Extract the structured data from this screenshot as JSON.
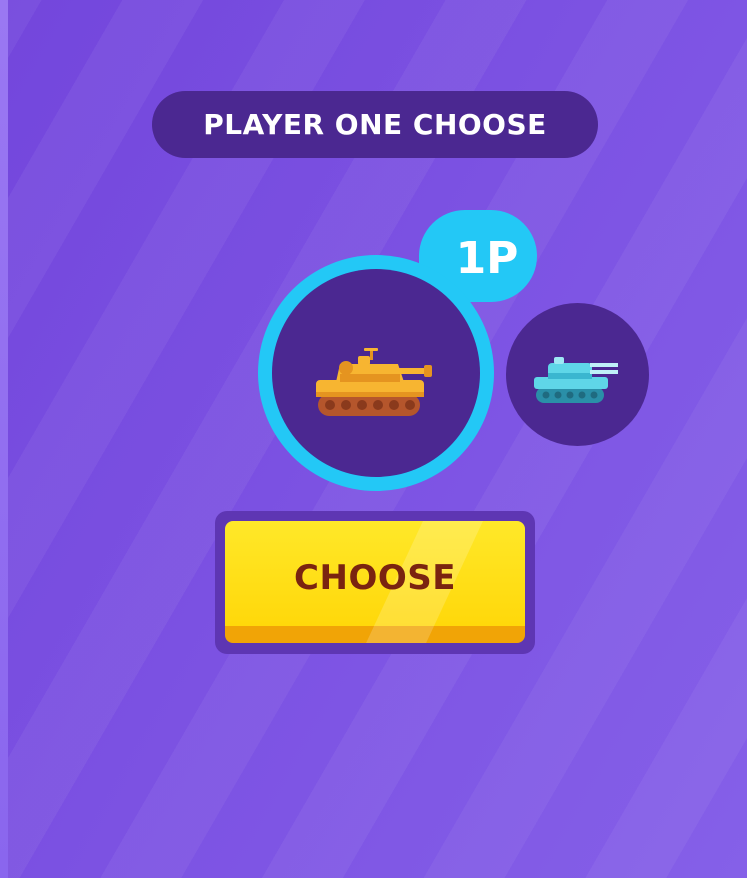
{
  "screen": {
    "title": "PLAYER ONE CHOOSE",
    "player_badge": "1P",
    "choose_button_label": "CHOOSE"
  },
  "tanks": [
    {
      "name": "yellow-tank",
      "selected": true,
      "color": "#f7b531",
      "icon": "tank-icon"
    },
    {
      "name": "blue-tank",
      "selected": false,
      "color": "#5fd6e8",
      "icon": "tank-icon"
    }
  ],
  "colors": {
    "background": "#7a52e0",
    "panel": "#4b2891",
    "highlight": "#23c8f6",
    "button": "#ffd80a",
    "button_text": "#7a2410"
  }
}
